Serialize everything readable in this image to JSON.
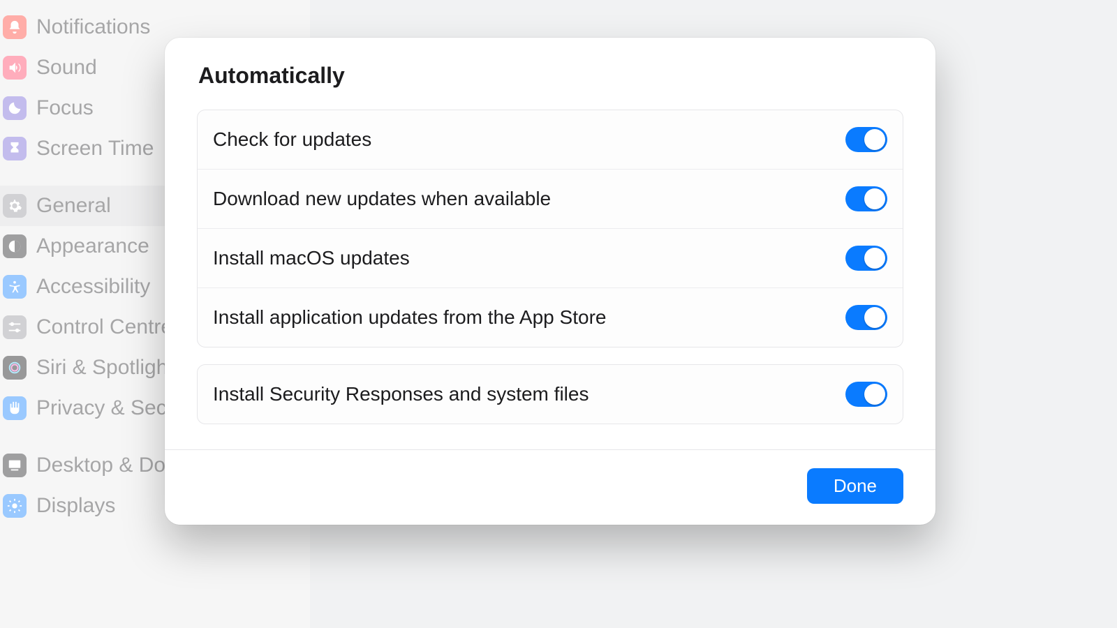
{
  "sidebar": {
    "items": [
      {
        "label": "Notifications",
        "icon": "bell-badge-icon",
        "color": "#ff4b3e"
      },
      {
        "label": "Sound",
        "icon": "speaker-wave-icon",
        "color": "#ff4b6b"
      },
      {
        "label": "Focus",
        "icon": "moon-icon",
        "color": "#7a6bd8"
      },
      {
        "label": "Screen Time",
        "icon": "hourglass-icon",
        "color": "#7a6bd8"
      },
      {
        "gap": true
      },
      {
        "label": "General",
        "icon": "gear-icon",
        "color": "#9a9aa0",
        "selected": true
      },
      {
        "label": "Appearance",
        "icon": "contrast-icon",
        "color": "#2b2b2d"
      },
      {
        "label": "Accessibility",
        "icon": "accessibility-icon",
        "color": "#1f87ff"
      },
      {
        "label": "Control Centre",
        "icon": "sliders-icon",
        "color": "#9a9aa0"
      },
      {
        "label": "Siri & Spotlight",
        "icon": "siri-icon",
        "color": "#1c1c1e"
      },
      {
        "label": "Privacy & Security",
        "icon": "hand-icon",
        "color": "#1f87ff"
      },
      {
        "gap": true
      },
      {
        "label": "Desktop & Dock",
        "icon": "desktop-icon",
        "color": "#2b2b2d"
      },
      {
        "label": "Displays",
        "icon": "sun-icon",
        "color": "#1f87ff"
      }
    ]
  },
  "sheet": {
    "title": "Automatically",
    "group1": [
      {
        "label": "Check for updates",
        "on": true
      },
      {
        "label": "Download new updates when available",
        "on": true
      },
      {
        "label": "Install macOS updates",
        "on": true
      },
      {
        "label": "Install application updates from the App Store",
        "on": true
      }
    ],
    "group2": [
      {
        "label": "Install Security Responses and system files",
        "on": true
      }
    ],
    "done": "Done"
  },
  "colors": {
    "accent": "#0a7bff"
  }
}
